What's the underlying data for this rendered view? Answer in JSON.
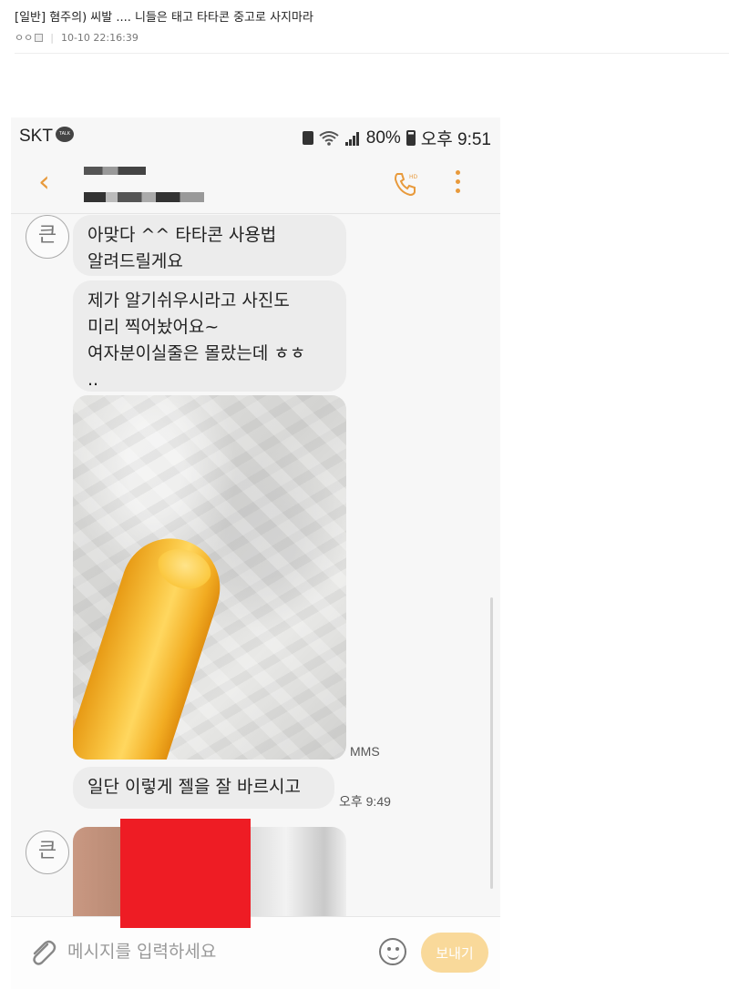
{
  "post": {
    "title": "[일반] 혐주의) 씨발 .... 니들은 태고 타타콘 중고로 사지마라",
    "author": "ㅇㅇ",
    "datetime": "10-10 22:16:39"
  },
  "status_bar": {
    "carrier": "SKT",
    "battery": "80%",
    "time": "오후 9:51"
  },
  "chat": {
    "avatar_char": "큰",
    "messages": [
      {
        "text": "아맞다 ^^ 타타콘 사용법\n알려드릴게요"
      },
      {
        "text": "제가 알기쉬우시라고 사진도\n미리 찍어놨어요~\n여자분이실줄은 몰랐는데 ㅎㅎ\n.."
      },
      {
        "type_label": "MMS"
      },
      {
        "text": "일단 이렇게 젤을 잘 바르시고",
        "time": "오후 9:49"
      }
    ]
  },
  "input": {
    "placeholder": "메시지를 입력하세요",
    "send_label": "보내기"
  },
  "icons": {
    "back": "chevron-left-icon",
    "call": "hd-call-icon",
    "more": "more-vertical-icon",
    "attach": "paperclip-icon",
    "emoji": "emoji-icon"
  },
  "colors": {
    "accent": "#e89a3c",
    "send_button": "#f9d99a",
    "censor": "#ee1c24"
  }
}
